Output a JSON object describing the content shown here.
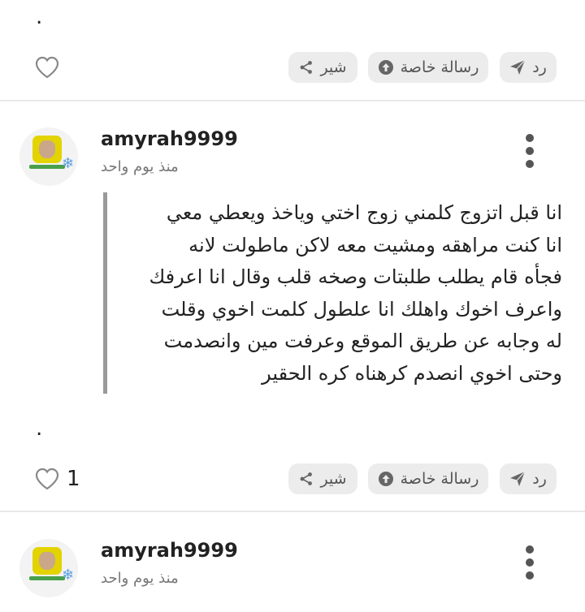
{
  "top_actions": {
    "separator": ".",
    "reply_label": "رد",
    "private_message_label": "رسالة خاصة",
    "share_label": "شير",
    "like_count": ""
  },
  "post": {
    "username": "amyrah9999",
    "time": "منذ يوم واحد",
    "quote_text": "انا قبل اتزوج كلمني زوج اختي وياخذ ويعطي معي\nانا كنت مراهقه ومشيت معه لاكن ماطولت لانه\nفجأه قام يطلب طلبتات وصخه قلب وقال انا اعرفك\nواعرف اخوك واهلك انا علطول كلمت اخوي وقلت\nله وجابه عن طريق الموقع وعرفت مين وانصدمت\nوحتى اخوي انصدم كرهناه كره الحقير",
    "separator": ".",
    "reply_label": "رد",
    "private_message_label": "رسالة خاصة",
    "share_label": "شير",
    "like_count": "1"
  },
  "next_post": {
    "username": "amyrah9999",
    "time": "منذ يوم واحد"
  },
  "icons": {
    "like": "heart-outline-icon",
    "reply": "paper-plane-icon",
    "private_message": "arrow-up-circle-icon",
    "share": "share-icon",
    "menu": "vertical-dots-icon"
  },
  "colors": {
    "button_bg": "#ececec",
    "button_text": "#555555",
    "quote_border": "#9a9a9a"
  }
}
